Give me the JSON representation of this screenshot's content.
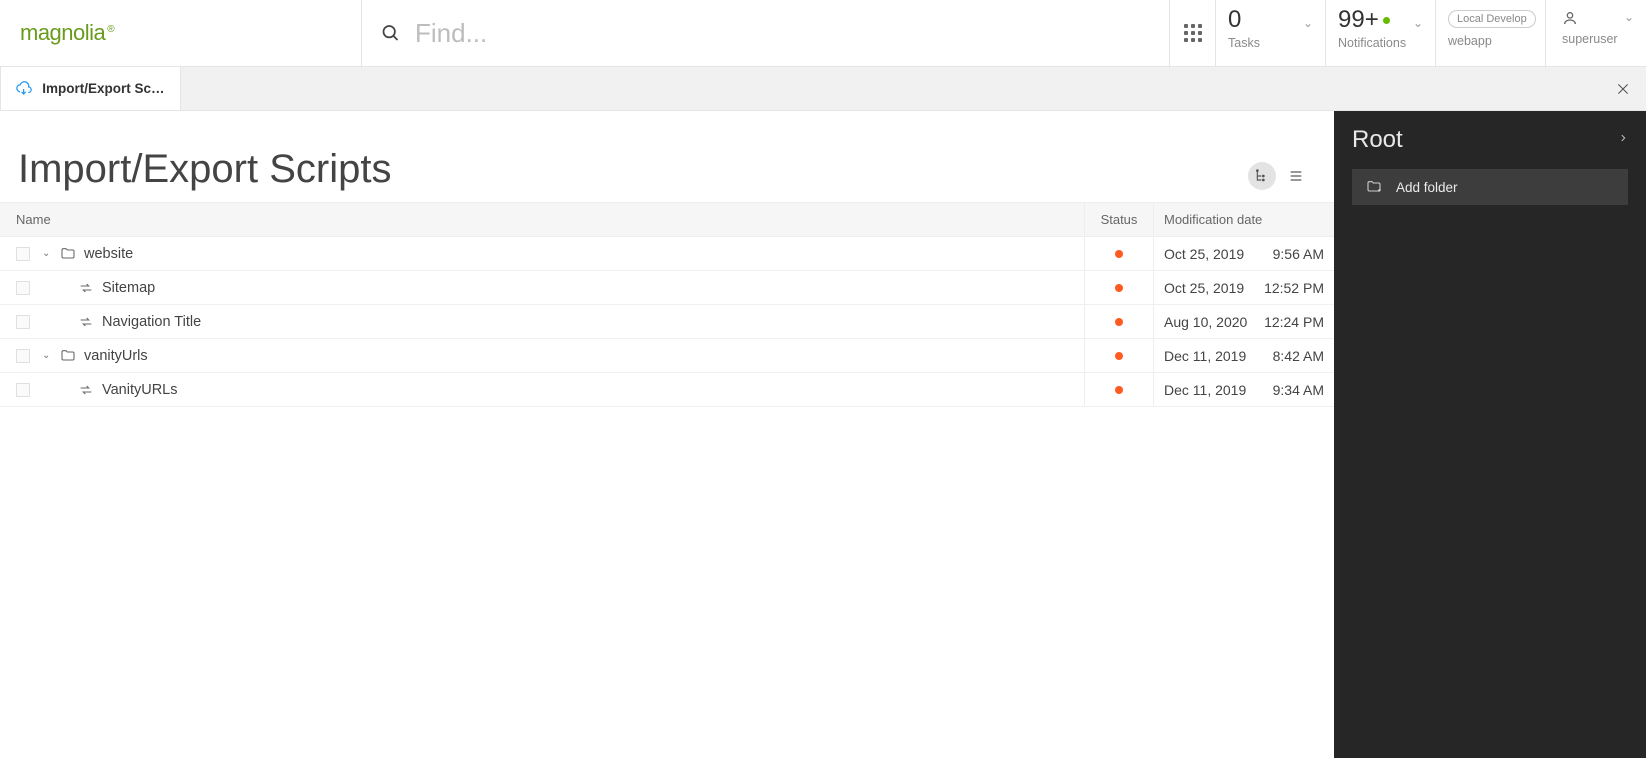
{
  "brand": "magnolia",
  "search": {
    "placeholder": "Find..."
  },
  "tasks": {
    "value": "0",
    "label": "Tasks"
  },
  "notifications": {
    "value": "99+",
    "label": "Notifications"
  },
  "environment": {
    "pill": "Local Develop",
    "label": "webapp"
  },
  "user": {
    "label": "superuser"
  },
  "tab": {
    "label": "Import/Export Scri..."
  },
  "page": {
    "title": "Import/Export Scripts"
  },
  "columns": {
    "name": "Name",
    "status": "Status",
    "mod": "Modification date"
  },
  "rows": [
    {
      "type": "folder",
      "depth": 0,
      "name": "website",
      "date": "Oct 25, 2019",
      "time": "9:56 AM"
    },
    {
      "type": "item",
      "depth": 1,
      "name": "Sitemap",
      "date": "Oct 25, 2019",
      "time": "12:52 PM"
    },
    {
      "type": "item",
      "depth": 1,
      "name": "Navigation Title",
      "date": "Aug 10, 2020",
      "time": "12:24 PM"
    },
    {
      "type": "folder",
      "depth": 0,
      "name": "vanityUrls",
      "date": "Dec 11, 2019",
      "time": "8:42 AM"
    },
    {
      "type": "item",
      "depth": 1,
      "name": "VanityURLs",
      "date": "Dec 11, 2019",
      "time": "9:34 AM"
    }
  ],
  "actions": {
    "title": "Root",
    "items": [
      {
        "label": "Add folder"
      }
    ]
  }
}
